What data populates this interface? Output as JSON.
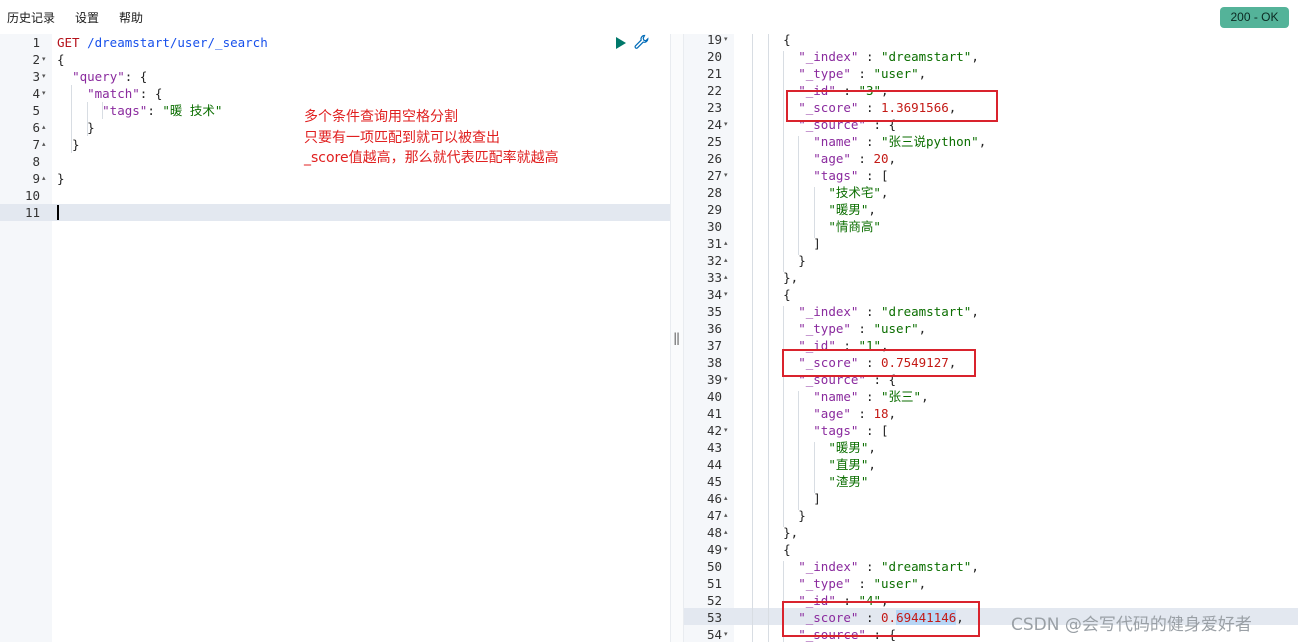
{
  "menu": {
    "history": "历史记录",
    "settings": "设置",
    "help": "帮助"
  },
  "status": "200 - OK",
  "notes": [
    "多个条件查询用空格分割",
    "只要有一项匹配到就可以被查出",
    "_score值越高，那么就代表匹配率就越高"
  ],
  "request_lines": [
    {
      "n": "1",
      "fold": "",
      "segs": [
        {
          "c": "kw",
          "t": "GET"
        },
        {
          "c": "n",
          "t": " /dreamstart/user/_search"
        }
      ]
    },
    {
      "n": "2",
      "fold": "▾",
      "segs": [
        {
          "c": "p",
          "t": "{"
        }
      ]
    },
    {
      "n": "3",
      "fold": "▾",
      "segs": [
        {
          "c": "p",
          "t": "  "
        },
        {
          "c": "k",
          "t": "\"query\""
        },
        {
          "c": "p",
          "t": ": {"
        }
      ]
    },
    {
      "n": "4",
      "fold": "▾",
      "segs": [
        {
          "c": "p",
          "t": "    "
        },
        {
          "c": "k",
          "t": "\"match\""
        },
        {
          "c": "p",
          "t": ": {"
        }
      ]
    },
    {
      "n": "5",
      "fold": "",
      "segs": [
        {
          "c": "p",
          "t": "      "
        },
        {
          "c": "k",
          "t": "\"tags\""
        },
        {
          "c": "p",
          "t": ": "
        },
        {
          "c": "s",
          "t": "\"暖 技术\""
        }
      ]
    },
    {
      "n": "6",
      "fold": "▴",
      "segs": [
        {
          "c": "p",
          "t": "    }"
        }
      ]
    },
    {
      "n": "7",
      "fold": "▴",
      "segs": [
        {
          "c": "p",
          "t": "  }"
        }
      ]
    },
    {
      "n": "8",
      "fold": "",
      "segs": []
    },
    {
      "n": "9",
      "fold": "▴",
      "segs": [
        {
          "c": "p",
          "t": "}"
        }
      ]
    },
    {
      "n": "10",
      "fold": "",
      "segs": []
    },
    {
      "n": "11",
      "fold": "",
      "segs": []
    }
  ],
  "response_lines": [
    {
      "n": "19",
      "fold": "▾",
      "segs": [
        {
          "c": "p",
          "t": "      {"
        }
      ]
    },
    {
      "n": "20",
      "fold": "",
      "segs": [
        {
          "c": "p",
          "t": "        "
        },
        {
          "c": "k",
          "t": "\"_index\""
        },
        {
          "c": "p",
          "t": " : "
        },
        {
          "c": "s",
          "t": "\"dreamstart\""
        },
        {
          "c": "p",
          "t": ","
        }
      ]
    },
    {
      "n": "21",
      "fold": "",
      "segs": [
        {
          "c": "p",
          "t": "        "
        },
        {
          "c": "k",
          "t": "\"_type\""
        },
        {
          "c": "p",
          "t": " : "
        },
        {
          "c": "s",
          "t": "\"user\""
        },
        {
          "c": "p",
          "t": ","
        }
      ]
    },
    {
      "n": "22",
      "fold": "",
      "segs": [
        {
          "c": "p",
          "t": "        "
        },
        {
          "c": "k",
          "t": "\"_id\""
        },
        {
          "c": "p",
          "t": " : "
        },
        {
          "c": "s",
          "t": "\"3\""
        },
        {
          "c": "p",
          "t": ","
        }
      ]
    },
    {
      "n": "23",
      "fold": "",
      "segs": [
        {
          "c": "p",
          "t": "        "
        },
        {
          "c": "k",
          "t": "\"_score\""
        },
        {
          "c": "p",
          "t": " : "
        },
        {
          "c": "m",
          "t": "1.3691566"
        },
        {
          "c": "p",
          "t": ","
        }
      ]
    },
    {
      "n": "24",
      "fold": "▾",
      "segs": [
        {
          "c": "p",
          "t": "        "
        },
        {
          "c": "k",
          "t": "\"_source\""
        },
        {
          "c": "p",
          "t": " : {"
        }
      ]
    },
    {
      "n": "25",
      "fold": "",
      "segs": [
        {
          "c": "p",
          "t": "          "
        },
        {
          "c": "k",
          "t": "\"name\""
        },
        {
          "c": "p",
          "t": " : "
        },
        {
          "c": "s",
          "t": "\"张三说python\""
        },
        {
          "c": "p",
          "t": ","
        }
      ]
    },
    {
      "n": "26",
      "fold": "",
      "segs": [
        {
          "c": "p",
          "t": "          "
        },
        {
          "c": "k",
          "t": "\"age\""
        },
        {
          "c": "p",
          "t": " : "
        },
        {
          "c": "m",
          "t": "20"
        },
        {
          "c": "p",
          "t": ","
        }
      ]
    },
    {
      "n": "27",
      "fold": "▾",
      "segs": [
        {
          "c": "p",
          "t": "          "
        },
        {
          "c": "k",
          "t": "\"tags\""
        },
        {
          "c": "p",
          "t": " : ["
        }
      ]
    },
    {
      "n": "28",
      "fold": "",
      "segs": [
        {
          "c": "p",
          "t": "            "
        },
        {
          "c": "s",
          "t": "\"技术宅\""
        },
        {
          "c": "p",
          "t": ","
        }
      ]
    },
    {
      "n": "29",
      "fold": "",
      "segs": [
        {
          "c": "p",
          "t": "            "
        },
        {
          "c": "s",
          "t": "\"暖男\""
        },
        {
          "c": "p",
          "t": ","
        }
      ]
    },
    {
      "n": "30",
      "fold": "",
      "segs": [
        {
          "c": "p",
          "t": "            "
        },
        {
          "c": "s",
          "t": "\"情商高\""
        }
      ]
    },
    {
      "n": "31",
      "fold": "▴",
      "segs": [
        {
          "c": "p",
          "t": "          ]"
        }
      ]
    },
    {
      "n": "32",
      "fold": "▴",
      "segs": [
        {
          "c": "p",
          "t": "        }"
        }
      ]
    },
    {
      "n": "33",
      "fold": "▴",
      "segs": [
        {
          "c": "p",
          "t": "      },"
        }
      ]
    },
    {
      "n": "34",
      "fold": "▾",
      "segs": [
        {
          "c": "p",
          "t": "      {"
        }
      ]
    },
    {
      "n": "35",
      "fold": "",
      "segs": [
        {
          "c": "p",
          "t": "        "
        },
        {
          "c": "k",
          "t": "\"_index\""
        },
        {
          "c": "p",
          "t": " : "
        },
        {
          "c": "s",
          "t": "\"dreamstart\""
        },
        {
          "c": "p",
          "t": ","
        }
      ]
    },
    {
      "n": "36",
      "fold": "",
      "segs": [
        {
          "c": "p",
          "t": "        "
        },
        {
          "c": "k",
          "t": "\"_type\""
        },
        {
          "c": "p",
          "t": " : "
        },
        {
          "c": "s",
          "t": "\"user\""
        },
        {
          "c": "p",
          "t": ","
        }
      ]
    },
    {
      "n": "37",
      "fold": "",
      "segs": [
        {
          "c": "p",
          "t": "        "
        },
        {
          "c": "k",
          "t": "\"_id\""
        },
        {
          "c": "p",
          "t": " : "
        },
        {
          "c": "s",
          "t": "\"1\""
        },
        {
          "c": "p",
          "t": ","
        }
      ]
    },
    {
      "n": "38",
      "fold": "",
      "segs": [
        {
          "c": "p",
          "t": "        "
        },
        {
          "c": "k",
          "t": "\"_score\""
        },
        {
          "c": "p",
          "t": " : "
        },
        {
          "c": "m",
          "t": "0.7549127"
        },
        {
          "c": "p",
          "t": ","
        }
      ]
    },
    {
      "n": "39",
      "fold": "▾",
      "segs": [
        {
          "c": "p",
          "t": "        "
        },
        {
          "c": "k",
          "t": "\"_source\""
        },
        {
          "c": "p",
          "t": " : {"
        }
      ]
    },
    {
      "n": "40",
      "fold": "",
      "segs": [
        {
          "c": "p",
          "t": "          "
        },
        {
          "c": "k",
          "t": "\"name\""
        },
        {
          "c": "p",
          "t": " : "
        },
        {
          "c": "s",
          "t": "\"张三\""
        },
        {
          "c": "p",
          "t": ","
        }
      ]
    },
    {
      "n": "41",
      "fold": "",
      "segs": [
        {
          "c": "p",
          "t": "          "
        },
        {
          "c": "k",
          "t": "\"age\""
        },
        {
          "c": "p",
          "t": " : "
        },
        {
          "c": "m",
          "t": "18"
        },
        {
          "c": "p",
          "t": ","
        }
      ]
    },
    {
      "n": "42",
      "fold": "▾",
      "segs": [
        {
          "c": "p",
          "t": "          "
        },
        {
          "c": "k",
          "t": "\"tags\""
        },
        {
          "c": "p",
          "t": " : ["
        }
      ]
    },
    {
      "n": "43",
      "fold": "",
      "segs": [
        {
          "c": "p",
          "t": "            "
        },
        {
          "c": "s",
          "t": "\"暖男\""
        },
        {
          "c": "p",
          "t": ","
        }
      ]
    },
    {
      "n": "44",
      "fold": "",
      "segs": [
        {
          "c": "p",
          "t": "            "
        },
        {
          "c": "s",
          "t": "\"直男\""
        },
        {
          "c": "p",
          "t": ","
        }
      ]
    },
    {
      "n": "45",
      "fold": "",
      "segs": [
        {
          "c": "p",
          "t": "            "
        },
        {
          "c": "s",
          "t": "\"渣男\""
        }
      ]
    },
    {
      "n": "46",
      "fold": "▴",
      "segs": [
        {
          "c": "p",
          "t": "          ]"
        }
      ]
    },
    {
      "n": "47",
      "fold": "▴",
      "segs": [
        {
          "c": "p",
          "t": "        }"
        }
      ]
    },
    {
      "n": "48",
      "fold": "▴",
      "segs": [
        {
          "c": "p",
          "t": "      },"
        }
      ]
    },
    {
      "n": "49",
      "fold": "▾",
      "segs": [
        {
          "c": "p",
          "t": "      {"
        }
      ]
    },
    {
      "n": "50",
      "fold": "",
      "segs": [
        {
          "c": "p",
          "t": "        "
        },
        {
          "c": "k",
          "t": "\"_index\""
        },
        {
          "c": "p",
          "t": " : "
        },
        {
          "c": "s",
          "t": "\"dreamstart\""
        },
        {
          "c": "p",
          "t": ","
        }
      ]
    },
    {
      "n": "51",
      "fold": "",
      "segs": [
        {
          "c": "p",
          "t": "        "
        },
        {
          "c": "k",
          "t": "\"_type\""
        },
        {
          "c": "p",
          "t": " : "
        },
        {
          "c": "s",
          "t": "\"user\""
        },
        {
          "c": "p",
          "t": ","
        }
      ]
    },
    {
      "n": "52",
      "fold": "",
      "segs": [
        {
          "c": "p",
          "t": "        "
        },
        {
          "c": "k",
          "t": "\"_id\""
        },
        {
          "c": "p",
          "t": " : "
        },
        {
          "c": "s",
          "t": "\"4\""
        },
        {
          "c": "p",
          "t": ","
        }
      ]
    },
    {
      "n": "53",
      "fold": "",
      "segs": [
        {
          "c": "p",
          "t": "        "
        },
        {
          "c": "k",
          "t": "\"_score\""
        },
        {
          "c": "p",
          "t": " : "
        },
        {
          "c": "m",
          "t": "0."
        },
        {
          "c": "m sel",
          "t": "69441146"
        },
        {
          "c": "p",
          "t": ","
        }
      ]
    },
    {
      "n": "54",
      "fold": "▾",
      "segs": [
        {
          "c": "p",
          "t": "        "
        },
        {
          "c": "k",
          "t": "\"_source\""
        },
        {
          "c": "p",
          "t": " : {"
        }
      ]
    }
  ],
  "watermark": "CSDN @会写代码的健身爱好者",
  "icons": {
    "run": "play-icon",
    "settings": "wrench-icon"
  },
  "colors": {
    "status_bg": "#54b399",
    "annotation": "#e02020"
  }
}
